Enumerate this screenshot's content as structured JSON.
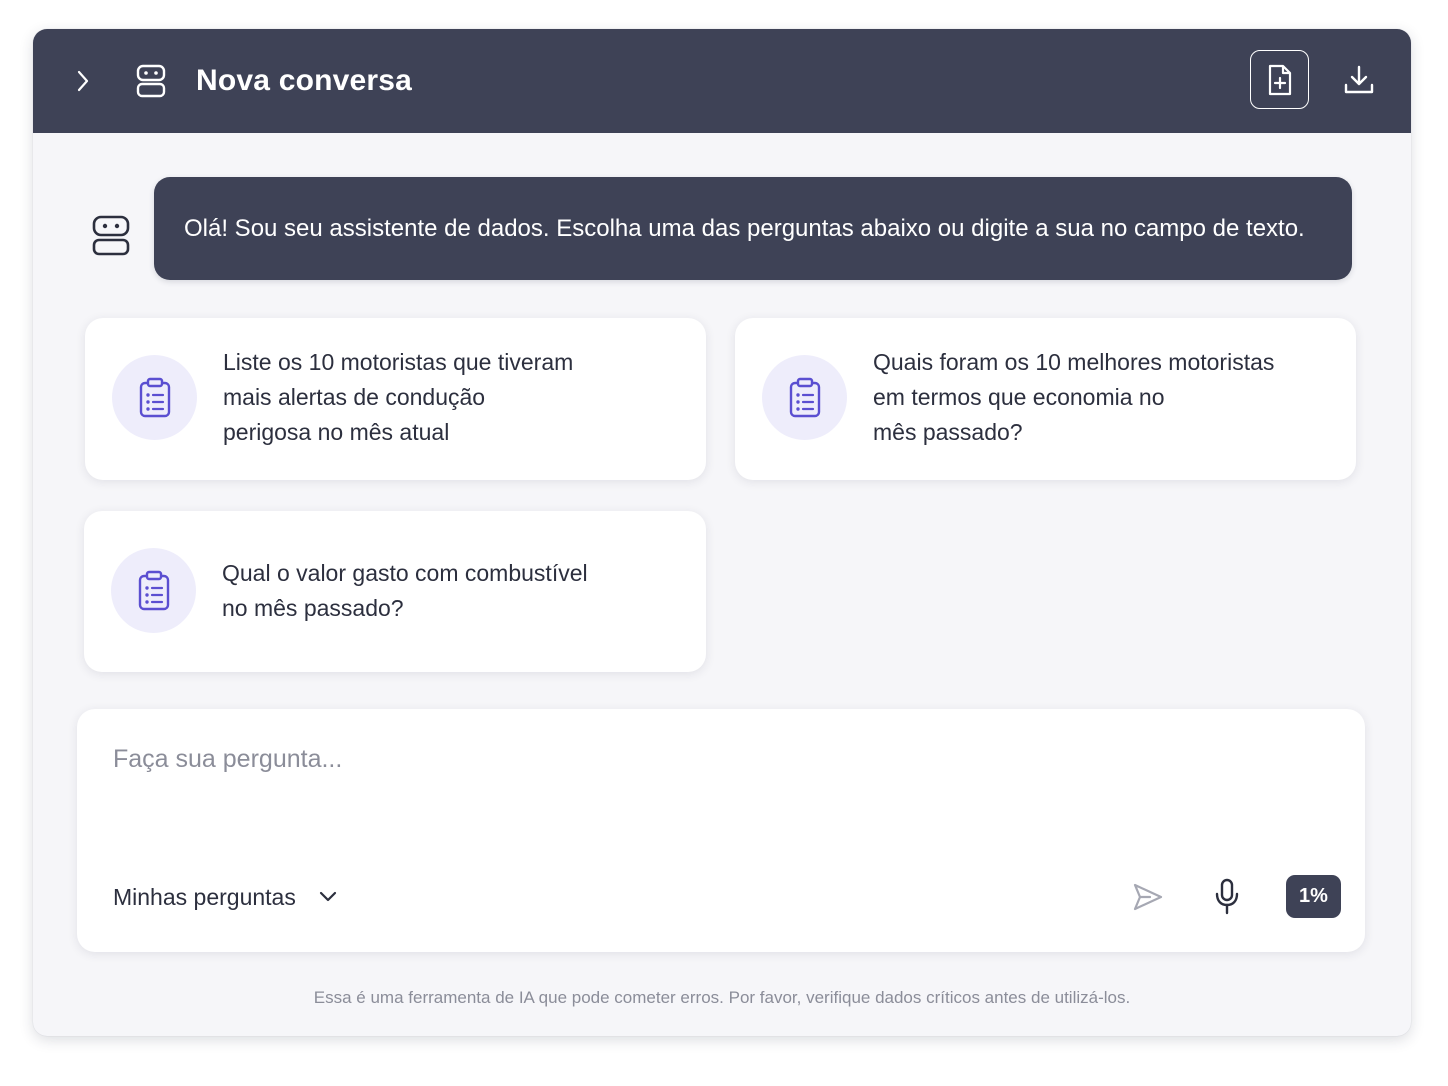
{
  "header": {
    "title": "Nova conversa",
    "expand_icon": "chevron-right-icon",
    "bot_icon": "robot-icon",
    "new_document_icon": "file-plus-icon",
    "download_icon": "download-icon"
  },
  "welcome_message": {
    "avatar_icon": "robot-icon",
    "text": "Olá! Sou seu assistente de dados. Escolha uma das perguntas abaixo ou digite a sua no campo de texto."
  },
  "suggestions": [
    {
      "icon": "clipboard-list-icon",
      "lines": [
        "Liste os 10 motoristas que tiveram",
        "mais alertas de condução",
        "perigosa no mês atual"
      ]
    },
    {
      "icon": "clipboard-list-icon",
      "lines": [
        "Quais foram os 10 melhores motoristas",
        "em termos que economia no",
        "mês passado?"
      ]
    },
    {
      "icon": "clipboard-list-icon",
      "lines": [
        "Qual o valor gasto com combustível",
        "no mês passado?"
      ]
    }
  ],
  "composer": {
    "placeholder": "Faça sua pergunta...",
    "value": "",
    "my_questions_label": "Minhas perguntas",
    "send_icon": "send-icon",
    "mic_icon": "microphone-icon",
    "usage_badge": "1%"
  },
  "disclaimer": "Essa é uma ferramenta de IA que pode cometer erros. Por favor, verifique dados críticos antes de utilizá-los.",
  "colors": {
    "header_bg": "#3e4256",
    "window_bg": "#f6f6f9",
    "accent_icon": "#5b4fd1",
    "icon_circle_bg": "#eeedfb",
    "text_primary": "#2c2f3e",
    "text_muted": "#8b8d99"
  }
}
